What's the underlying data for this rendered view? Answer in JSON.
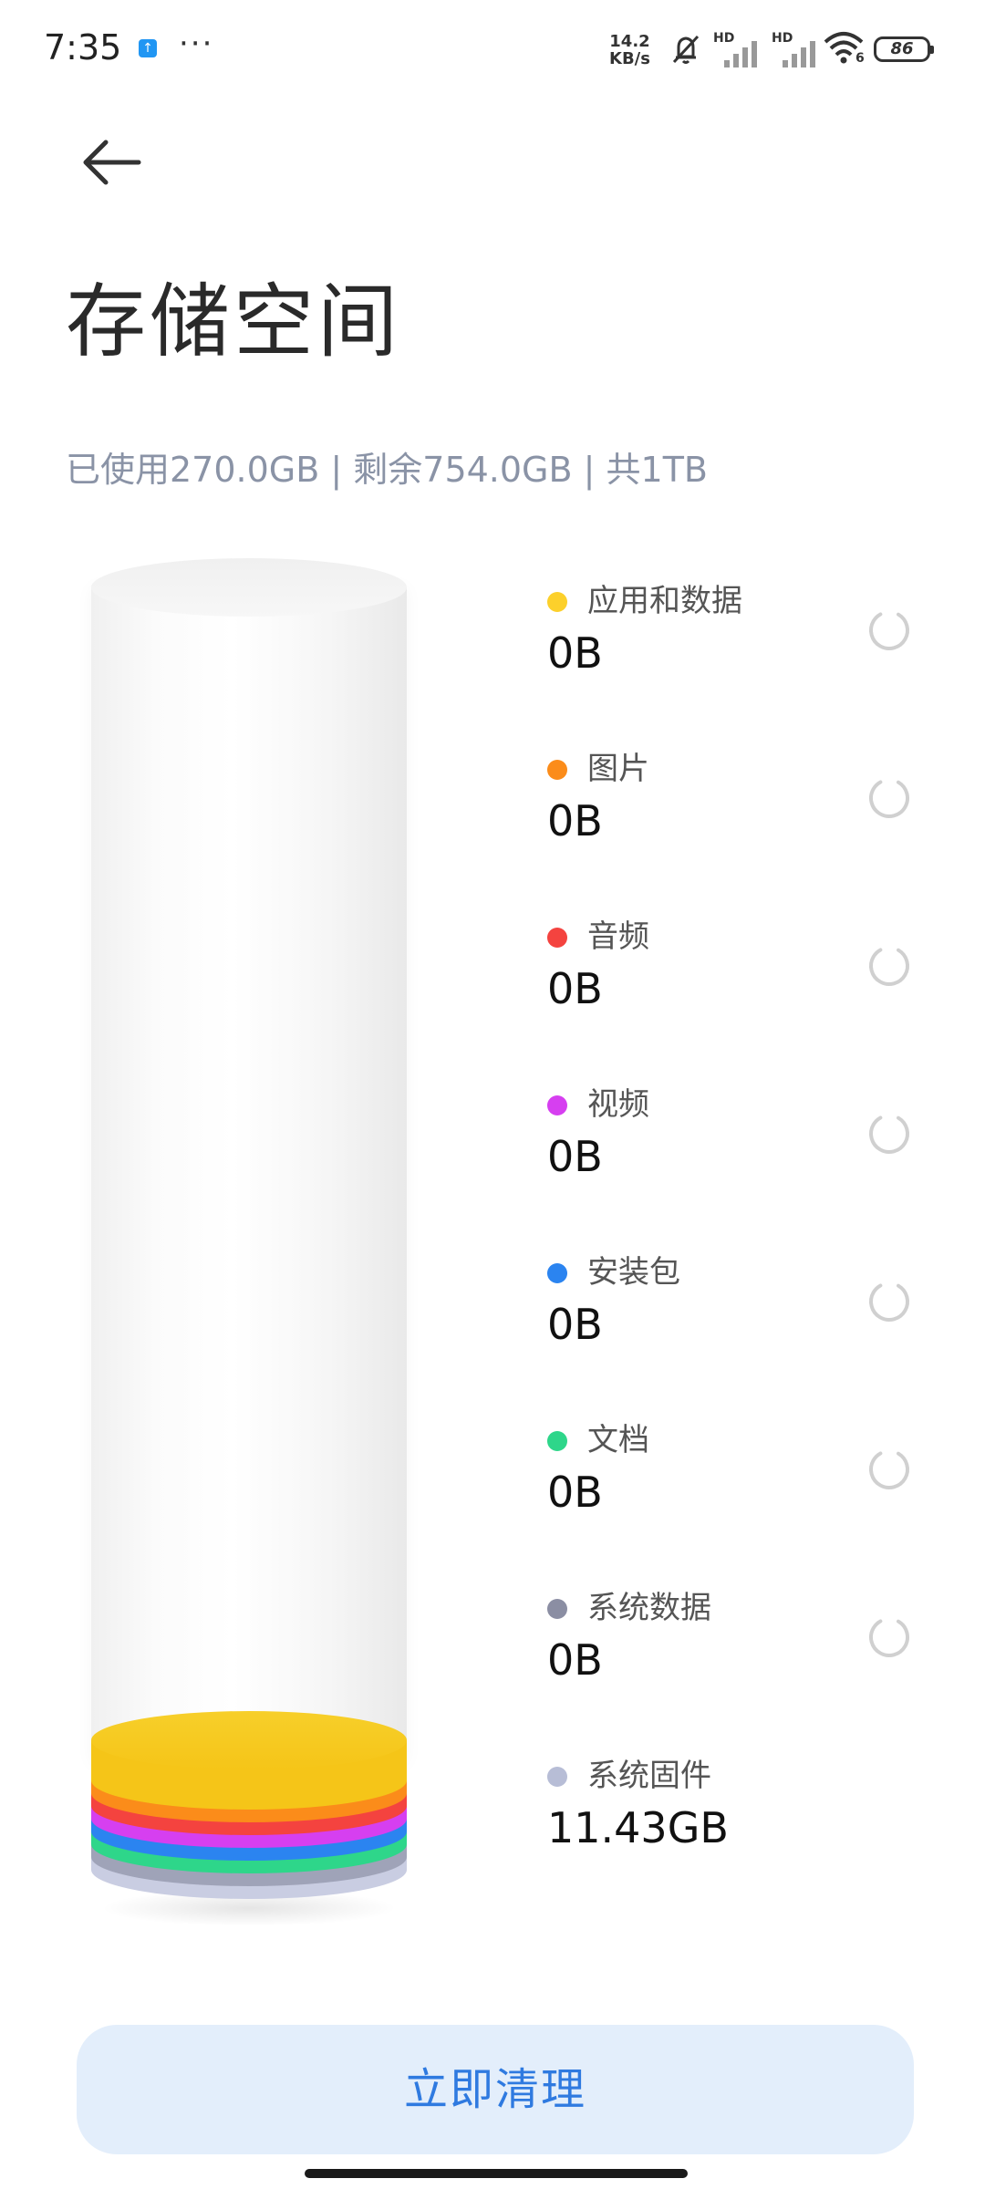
{
  "status_bar": {
    "time": "7:35",
    "notification_icon": "upload-app-icon",
    "more_indicator": "···",
    "net_speed_value": "14.2",
    "net_speed_unit": "KB/s",
    "silent_icon": "bell-off-icon",
    "sim1_label": "HD",
    "sim2_label": "HD",
    "wifi_icon": "wifi-6-icon",
    "wifi_badge": "6",
    "battery_level": "86"
  },
  "header": {
    "back_icon": "arrow-left-icon",
    "title": "存储空间",
    "summary": "已使用270.0GB | 剩余754.0GB | 共1TB"
  },
  "categories": [
    {
      "name": "应用和数据",
      "size": "0B",
      "color": "#fcd02b",
      "loading": true
    },
    {
      "name": "图片",
      "size": "0B",
      "color": "#fb8c1a",
      "loading": true
    },
    {
      "name": "音频",
      "size": "0B",
      "color": "#f4433f",
      "loading": true
    },
    {
      "name": "视频",
      "size": "0B",
      "color": "#d63ff0",
      "loading": true
    },
    {
      "name": "安装包",
      "size": "0B",
      "color": "#2b84f0",
      "loading": true
    },
    {
      "name": "文档",
      "size": "0B",
      "color": "#2ed68a",
      "loading": true
    },
    {
      "name": "系统数据",
      "size": "0B",
      "color": "#8b8ea3",
      "loading": true
    },
    {
      "name": "系统固件",
      "size": "11.43GB",
      "color": "#b7bdd6",
      "loading": false
    }
  ],
  "cylinder": {
    "used_fraction": 0.26,
    "layer_colors": [
      "#c9cde2",
      "#9fa3b8",
      "#2ed68a",
      "#2b84f0",
      "#d63ff0",
      "#f4433f",
      "#fb8c1a",
      "#f5c518"
    ]
  },
  "actions": {
    "clean_label": "立即清理"
  }
}
